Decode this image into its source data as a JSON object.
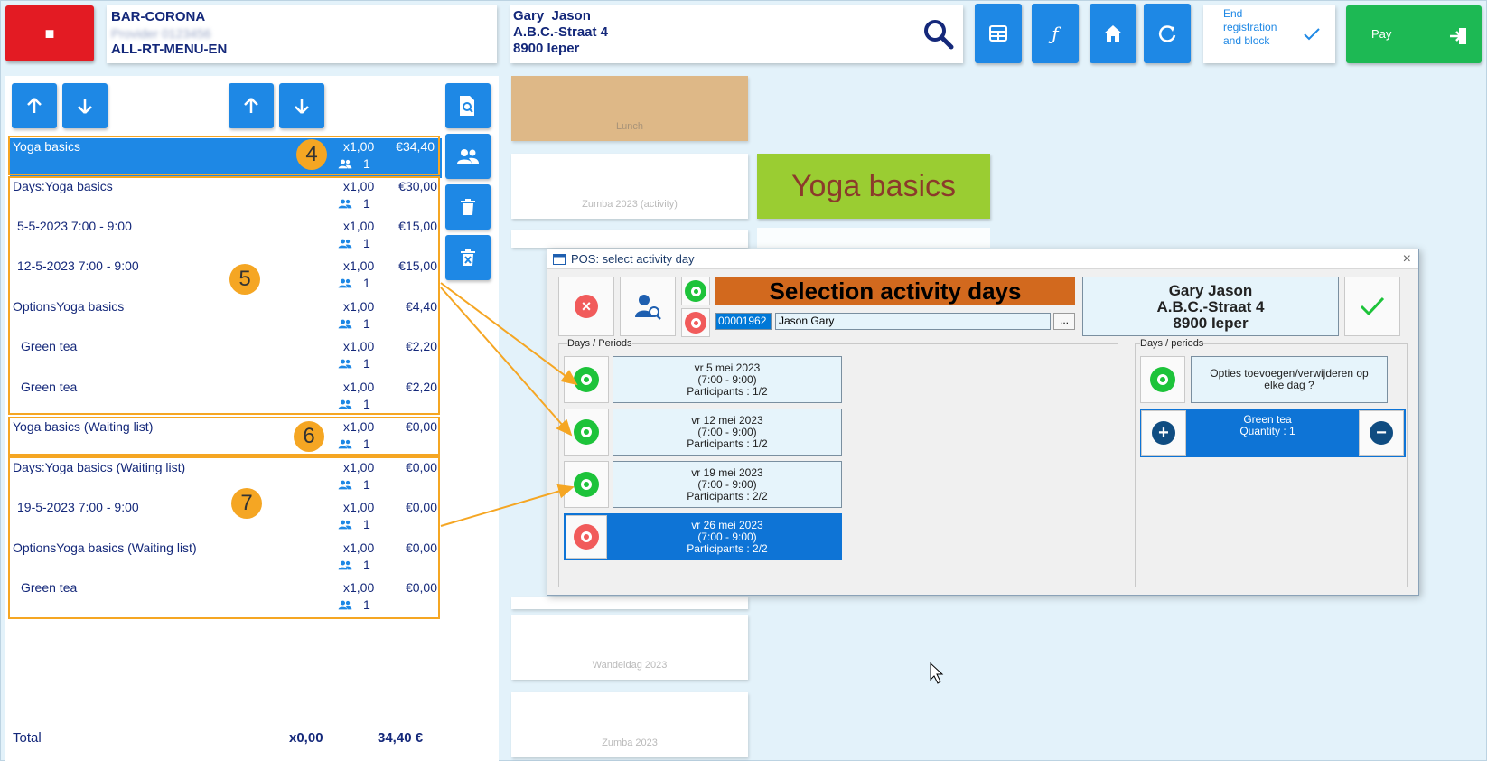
{
  "header": {
    "stop_symbol": "■",
    "location": "BAR-CORONA",
    "location_sub": "Provider 0123456",
    "menu": "ALL-RT-MENU-EN",
    "customer_name": "Gary  Jason",
    "customer_street": "A.B.C.-Straat 4",
    "customer_city": "8900 Ieper",
    "end_registration_label": "End registration and block",
    "pay_label": "Pay"
  },
  "order": {
    "lines": [
      {
        "name": "Yoga basics",
        "qty": "x1,00",
        "price": "€34,40",
        "people": "1"
      },
      {
        "name": "Days:Yoga basics",
        "qty": "x1,00",
        "price": "€30,00",
        "people": "1"
      },
      {
        "name": "5-5-2023 7:00 - 9:00",
        "qty": "x1,00",
        "price": "€15,00",
        "people": "1"
      },
      {
        "name": "12-5-2023 7:00 - 9:00",
        "qty": "x1,00",
        "price": "€15,00",
        "people": "1"
      },
      {
        "name": "OptionsYoga basics",
        "qty": "x1,00",
        "price": "€4,40",
        "people": "1"
      },
      {
        "name": "Green tea",
        "qty": "x1,00",
        "price": "€2,20",
        "people": "1"
      },
      {
        "name": "Green tea",
        "qty": "x1,00",
        "price": "€2,20",
        "people": "1"
      },
      {
        "name": "Yoga basics (Waiting list)",
        "qty": "x1,00",
        "price": "€0,00",
        "people": "1"
      },
      {
        "name": "Days:Yoga basics (Waiting list)",
        "qty": "x1,00",
        "price": "€0,00",
        "people": "1"
      },
      {
        "name": "19-5-2023 7:00 - 9:00",
        "qty": "x1,00",
        "price": "€0,00",
        "people": "1"
      },
      {
        "name": "OptionsYoga basics (Waiting list)",
        "qty": "x1,00",
        "price": "€0,00",
        "people": "1"
      },
      {
        "name": "Green tea",
        "qty": "x1,00",
        "price": "€0,00",
        "people": "1"
      }
    ],
    "total_label": "Total",
    "total_qty": "x0,00",
    "total_amount": "34,40 €"
  },
  "badges": [
    "4",
    "5",
    "6",
    "7"
  ],
  "tiles": [
    "Lunch",
    "Zumba 2023 (activity)",
    "",
    "",
    "",
    "",
    "Wandeldag 2023",
    "Zumba 2023"
  ],
  "product_tile": "Yoga basics",
  "dialog": {
    "title": "POS: select activity day",
    "close": "×",
    "heading": "Selection activity days",
    "customer_code": "00001962",
    "customer_search_name": "Jason Gary",
    "more_button": "...",
    "customer_name": "Gary Jason",
    "customer_street": "A.B.C.-Straat 4",
    "customer_city": "8900 Ieper",
    "left_section": "Days / Periods",
    "right_section": "Days / periods",
    "days": [
      {
        "date": "vr 5 mei 2023",
        "time": "(7:00 - 9:00)",
        "participants": "Participants : 1/2"
      },
      {
        "date": "vr 12 mei 2023",
        "time": "(7:00 - 9:00)",
        "participants": "Participants : 1/2"
      },
      {
        "date": "vr 19 mei 2023",
        "time": "(7:00 - 9:00)",
        "participants": "Participants : 2/2"
      },
      {
        "date": "vr 26 mei 2023",
        "time": "(7:00 - 9:00)",
        "participants": "Participants : 2/2"
      }
    ],
    "options_question": "Opties toevoegen/verwijderen op elke dag ?",
    "option_name": "Green tea",
    "option_qty": "Quantity : 1"
  },
  "colors": {
    "accent": "#1e88e5",
    "pay": "#1db954",
    "stop": "#e31b23",
    "badge": "#f5a623",
    "heading": "#d2691e",
    "product_tile": "#9acd32"
  }
}
